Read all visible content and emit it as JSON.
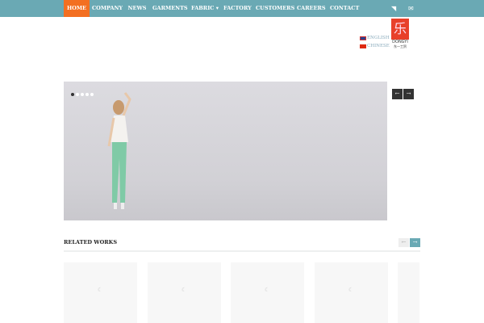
{
  "nav": {
    "items": [
      "HOME",
      "COMPANY",
      "NEWS",
      "GARMENTS",
      "FABRIC",
      "FACTORY",
      "CUSTOMERS",
      "CAREERS",
      "CONTACT"
    ],
    "fabric_caret": "▾",
    "icons": [
      "rss-icon",
      "mail-icon"
    ]
  },
  "languages": {
    "english": "ENGLISH",
    "chinese": "CHINESE"
  },
  "logo": {
    "brand": "DONGYI",
    "sub": "东一工贸"
  },
  "slider": {
    "prev": "←",
    "next": "→",
    "slide_count": 5,
    "active_slide": 1
  },
  "related": {
    "title": "RELATED WORKS",
    "prev": "←",
    "next": "→"
  },
  "colors": {
    "nav": "#6aa9b4",
    "active": "#f36f21"
  }
}
